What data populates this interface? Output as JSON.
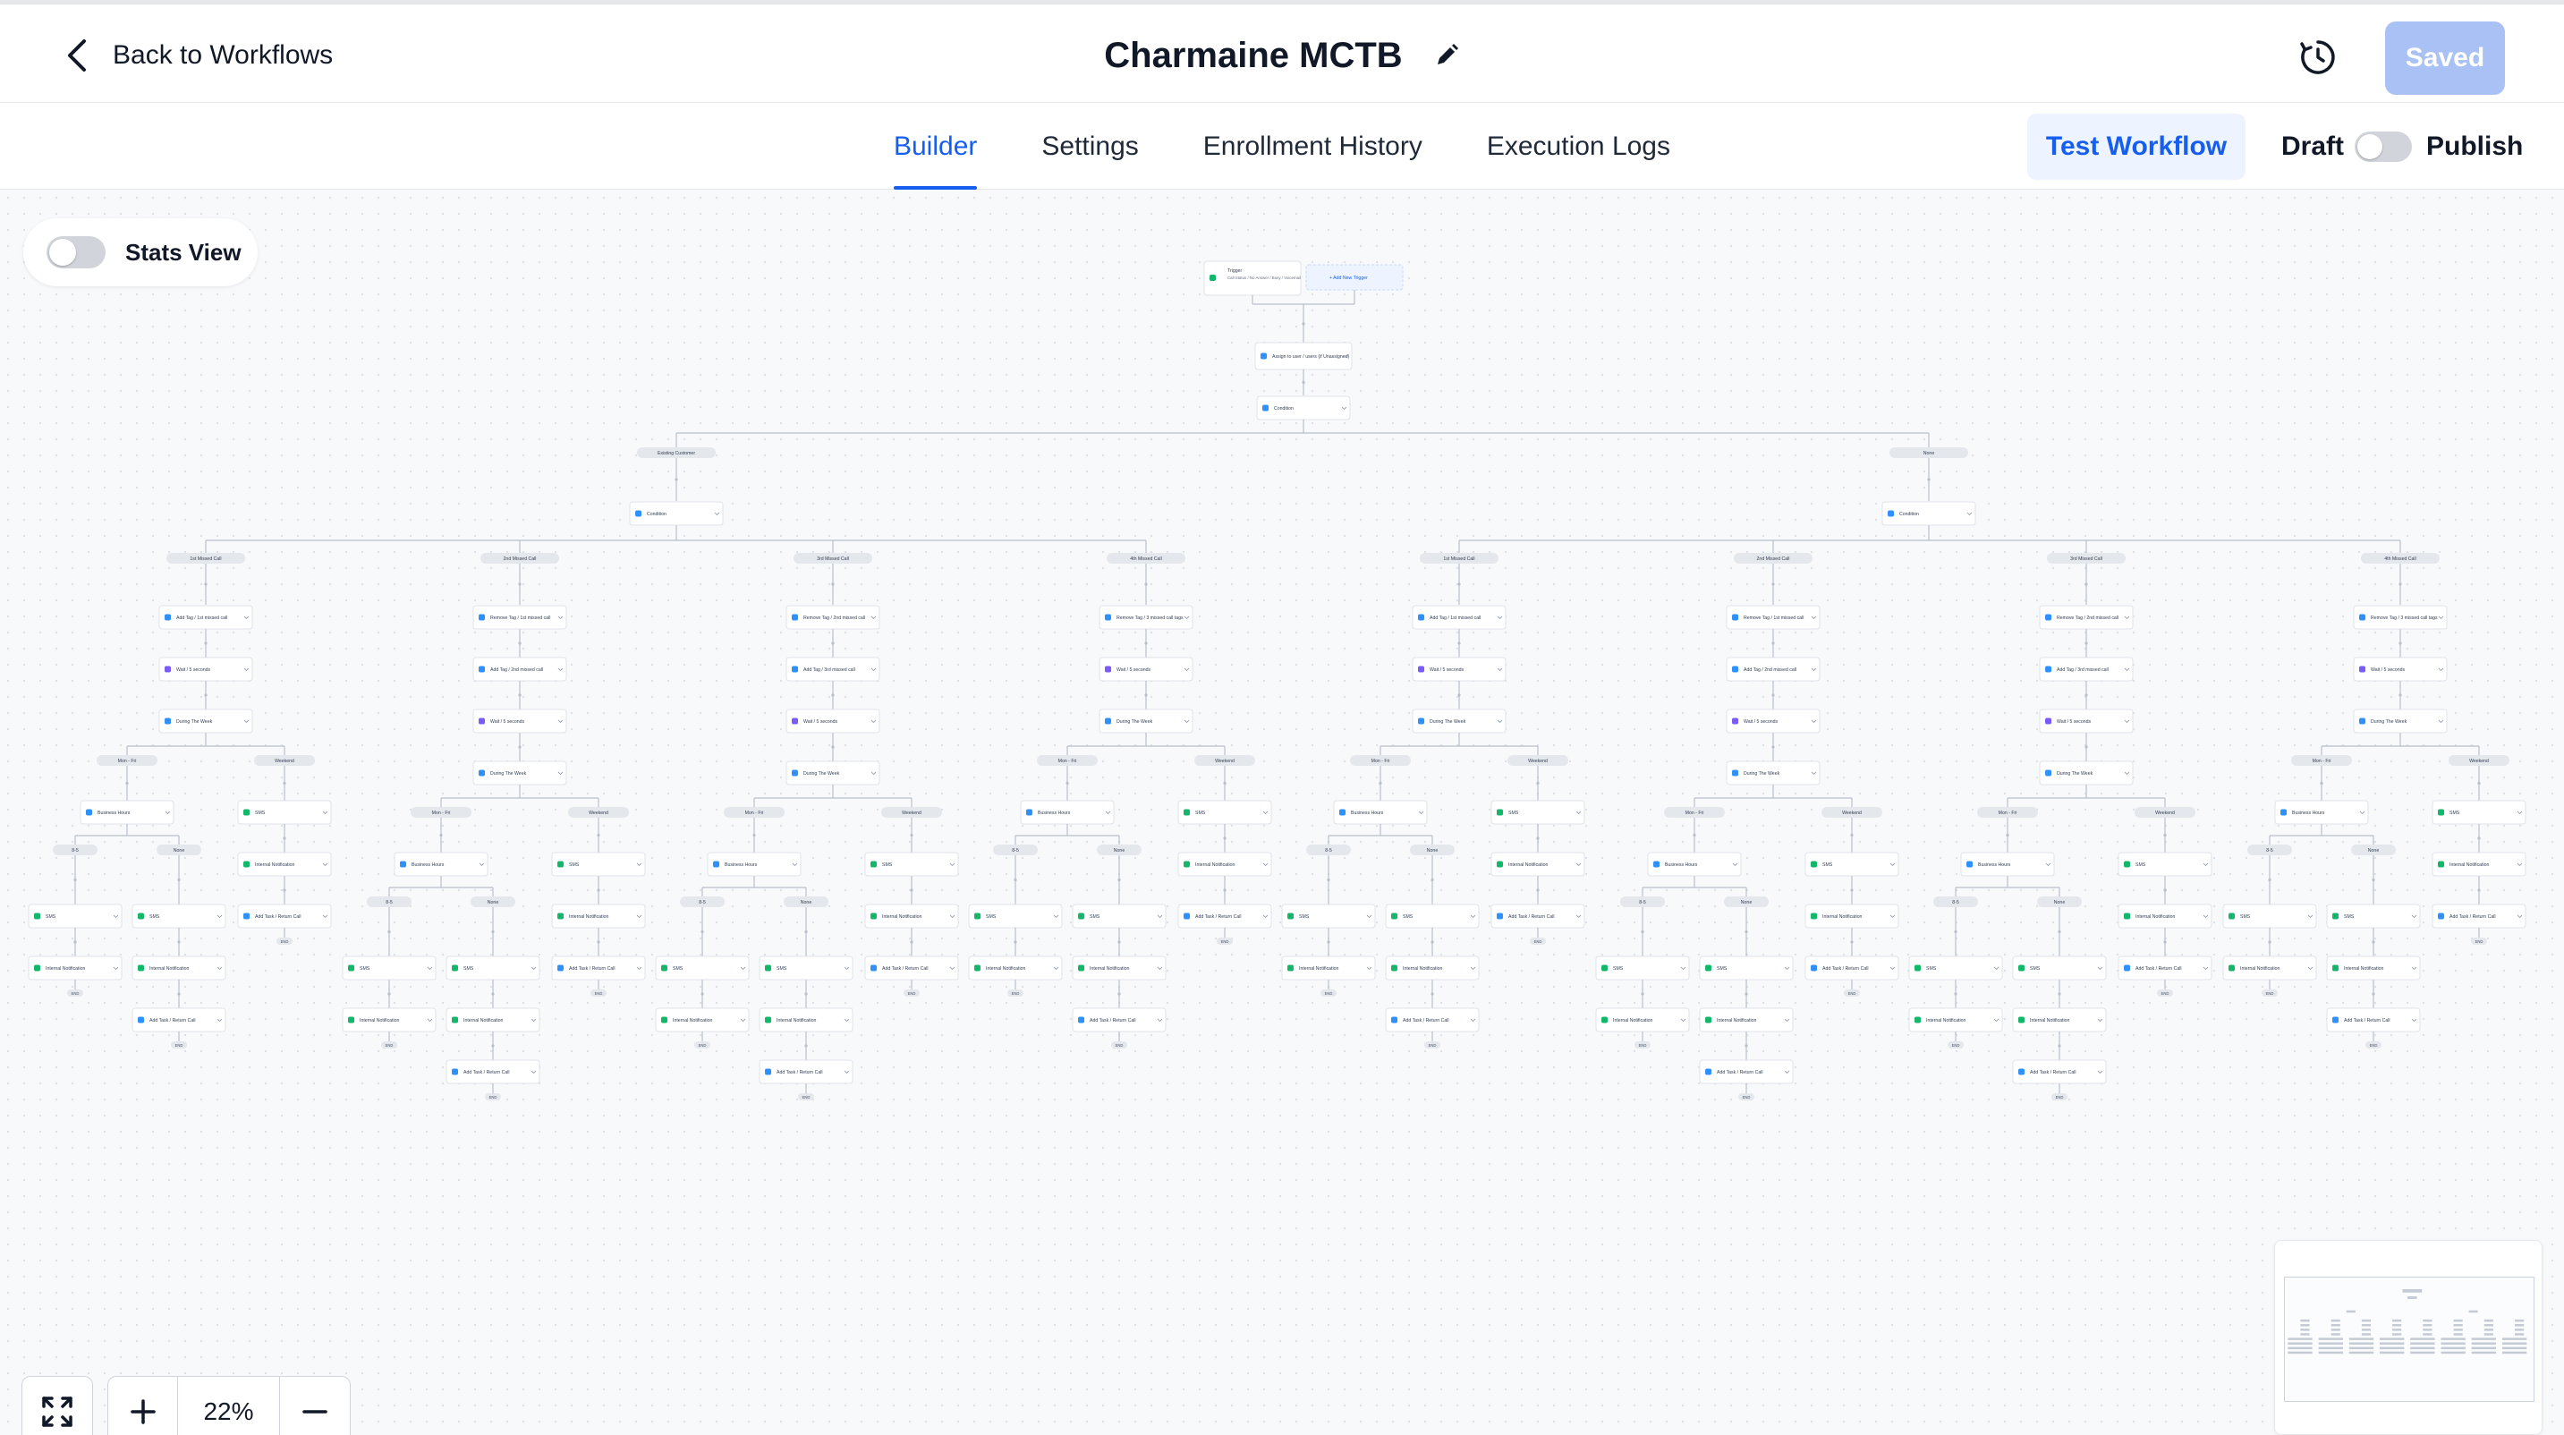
{
  "header": {
    "back_label": "Back to Workflows",
    "title": "Charmaine MCTB",
    "saved_label": "Saved"
  },
  "tabs": [
    "Builder",
    "Settings",
    "Enrollment History",
    "Execution Logs"
  ],
  "active_tab": "Builder",
  "actions": {
    "test_label": "Test Workflow",
    "draft_label": "Draft",
    "publish_label": "Publish",
    "published": false
  },
  "canvas": {
    "stats_label": "Stats View",
    "stats_enabled": false,
    "zoom_label": "22%"
  },
  "workflow": {
    "trigger_label": "Trigger",
    "trigger_detail": "Call Status / No Answer / Busy / Voicemail",
    "add_trigger_label": "Add New Trigger",
    "assign_label": "Assign to user / users (if Unassigned)",
    "condition_label": "Condition",
    "top_branches": [
      "Existing Customer",
      "None"
    ],
    "call_branches": [
      "1st Missed Call",
      "2nd Missed Call",
      "3rd Missed Call",
      "4th Missed Call"
    ],
    "first_actions": [
      "Add Tag / 1st missed call",
      "Remove Tag / 1st missed call",
      "Remove Tag / 2nd missed call",
      "Remove Tag / 3 missed call tags"
    ],
    "second_tags": [
      "Add Tag / 2nd missed call",
      "Add Tag / 3rd missed call"
    ],
    "wait_label": "Wait / 5 seconds",
    "during_week_label": "During The Week",
    "day_branches": [
      "Mon - Fri",
      "Weekend"
    ],
    "business_hours_label": "Business Hours",
    "hour_branches": [
      "8-5",
      "None"
    ],
    "sms_label": "SMS",
    "notification_label": "Internal Notification",
    "task_label": "Add Task / Return Call",
    "end_label": "END",
    "colors": {
      "accent": "#155eef",
      "node_border": "#dfe3e8",
      "connector": "#b8bfca",
      "pill": "#e4e7ec",
      "sms_icon": "#12b76a",
      "wait_icon": "#7a5af8",
      "tag_icon": "#2e90fa"
    }
  }
}
